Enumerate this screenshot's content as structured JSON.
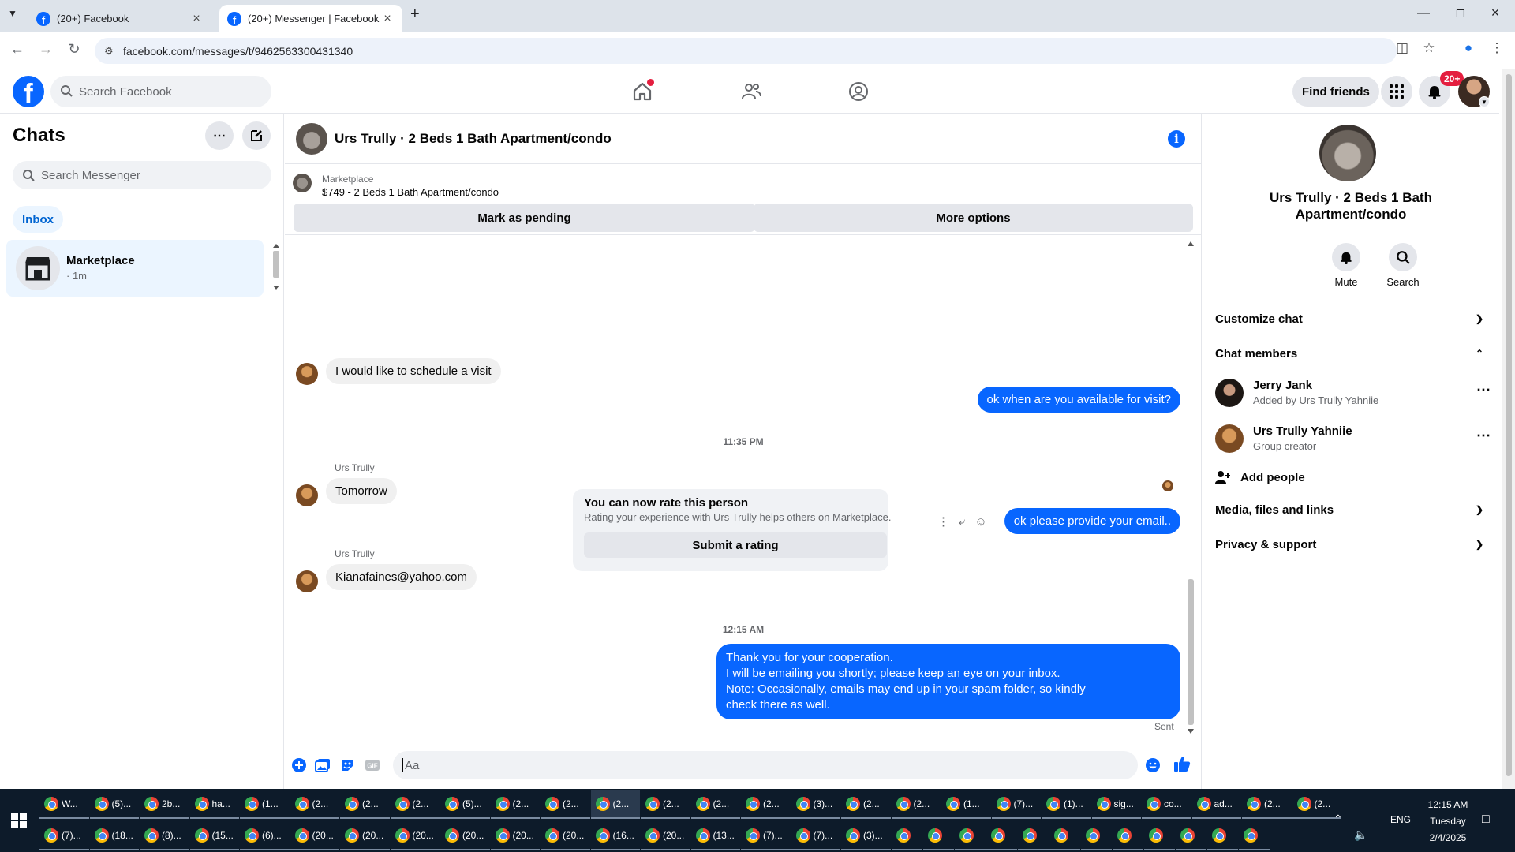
{
  "browser": {
    "tabs": [
      {
        "title": "(20+) Facebook",
        "active": false
      },
      {
        "title": "(20+) Messenger | Facebook",
        "active": true
      }
    ],
    "url": "facebook.com/messages/t/9462563300431340"
  },
  "header": {
    "search_placeholder": "Search Facebook",
    "find_friends": "Find friends",
    "notif_count": "20+"
  },
  "sidebar": {
    "title": "Chats",
    "search_placeholder": "Search Messenger",
    "inbox_tab": "Inbox",
    "chats": [
      {
        "name": "Marketplace",
        "time": "· 1m"
      }
    ]
  },
  "conversation": {
    "title": "Urs Trully · 2 Beds 1 Bath Apartment/condo",
    "listing": {
      "source": "Marketplace",
      "title": "$749 - 2 Beds 1 Bath Apartment/condo",
      "mark_pending": "Mark as pending",
      "more_options": "More options"
    },
    "messages": [
      {
        "text": "I would like to schedule a visit"
      },
      {
        "text": "ok when are you available for visit?"
      },
      {
        "timestamp": "11:35 PM"
      },
      {
        "sender": "Urs Trully",
        "text": "Tomorrow"
      },
      {
        "text": "ok please provide your email.."
      },
      {
        "sender": "Urs Trully",
        "text": "Kianafaines@yahoo.com"
      }
    ],
    "rating": {
      "title": "You can now rate this person",
      "subtitle": "Rating your experience with Urs Trully helps others on Marketplace.",
      "button": "Submit a rating"
    },
    "timestamp2": "12:15 AM",
    "final_message": [
      "Thank you for your cooperation.",
      "I will be emailing you shortly; please keep an eye on your inbox.",
      "Note: Occasionally, emails may end up in your spam folder, so kindly",
      "check there as well."
    ],
    "status": "Sent",
    "composer_placeholder": "Aa"
  },
  "info_panel": {
    "title": "Urs Trully · 2 Beds 1 Bath Apartment/condo",
    "actions": [
      {
        "label": "Mute"
      },
      {
        "label": "Search"
      }
    ],
    "sections": {
      "customize": "Customize chat",
      "members": "Chat members",
      "media": "Media, files and links",
      "privacy": "Privacy & support"
    },
    "members": [
      {
        "name": "Jerry Jank",
        "sub": "Added by Urs Trully Yahniie"
      },
      {
        "name": "Urs Trully Yahniie",
        "sub": "Group creator"
      }
    ],
    "add_people": "Add people"
  },
  "taskbar": {
    "row1": [
      "W...",
      "(5)...",
      "2b...",
      "ha...",
      "(1...",
      "(2...",
      "(2...",
      "(2...",
      "(5)...",
      "(2...",
      "(2...",
      "(2...",
      "(2...",
      "(2...",
      "(2...",
      "(3)...",
      "(2...",
      "(2...",
      "(1...",
      "(7)...",
      "(1)...",
      "sig...",
      "co...",
      "ad...",
      "(2...",
      "(2..."
    ],
    "row2": [
      "(7)...",
      "(18...",
      "(8)...",
      "(15...",
      "(6)...",
      "(20...",
      "(20...",
      "(20...",
      "(20...",
      "(20...",
      "(20...",
      "(16...",
      "(20...",
      "(13...",
      "(7)...",
      "(7)...",
      "(3)..."
    ],
    "tray": {
      "lang": "ENG",
      "time": "12:15 AM",
      "day": "Tuesday",
      "date": "2/4/2025"
    }
  }
}
